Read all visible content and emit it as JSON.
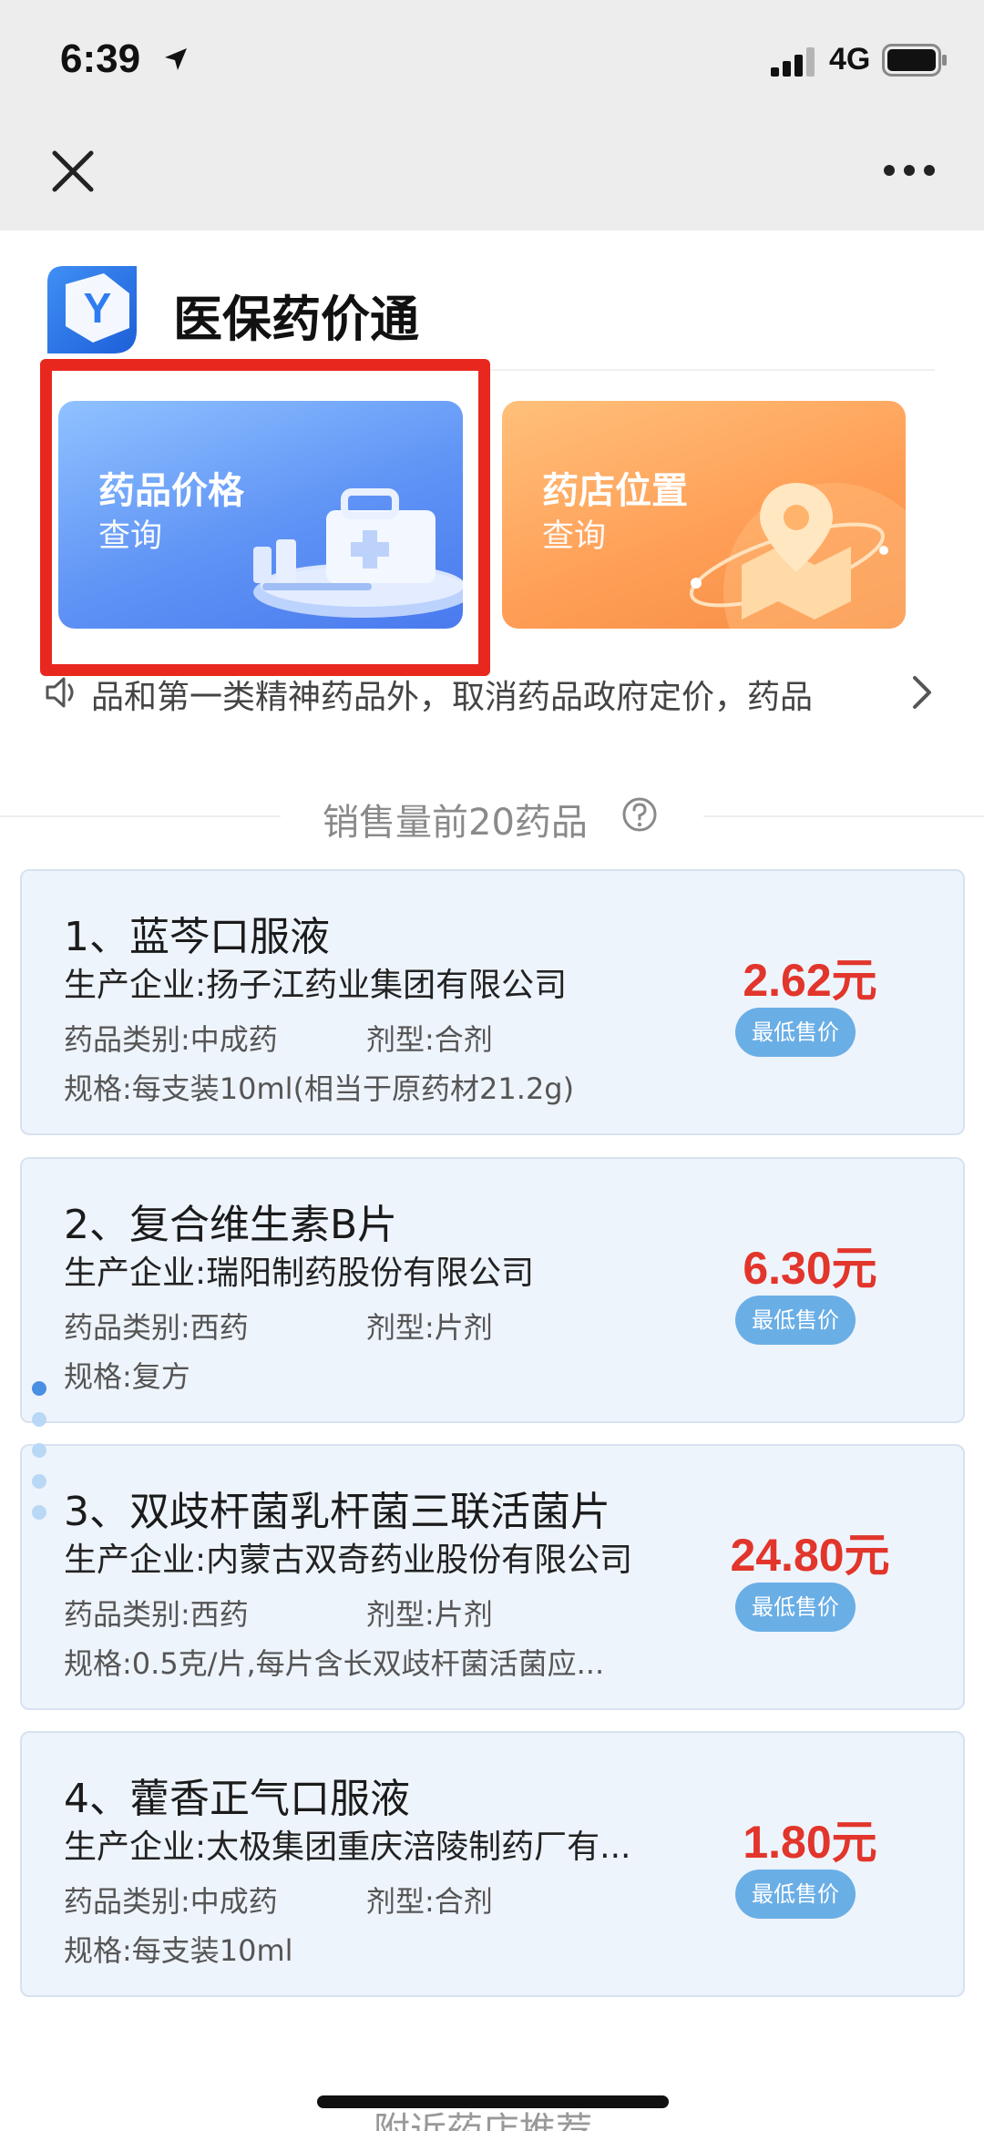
{
  "status_bar": {
    "time": "6:39",
    "network": "4G"
  },
  "header": {
    "title": "医保药价通",
    "logo_letter": "Y"
  },
  "features": [
    {
      "title": "药品价格",
      "subtitle": "查询"
    },
    {
      "title": "药店位置",
      "subtitle": "查询"
    }
  ],
  "notice": {
    "text": "品和第一类精神药品外，取消药品政府定价，药品"
  },
  "section": {
    "title": "销售量前20药品"
  },
  "drugs": [
    {
      "name": "1、蓝芩口服液",
      "maker": "生产企业:扬子江药业集团有限公司",
      "category": "药品类别:中成药",
      "form": "剂型:合剂",
      "spec": "规格:每支装10ml(相当于原药材21.2g)",
      "price": "2.62元",
      "badge": "最低售价"
    },
    {
      "name": "2、复合维生素B片",
      "maker": "生产企业:瑞阳制药股份有限公司",
      "category": "药品类别:西药",
      "form": "剂型:片剂",
      "spec": "规格:复方",
      "price": "6.30元",
      "badge": "最低售价"
    },
    {
      "name": "3、双歧杆菌乳杆菌三联活菌片",
      "maker": "生产企业:内蒙古双奇药业股份有限公司",
      "category": "药品类别:西药",
      "form": "剂型:片剂",
      "spec": "规格:0.5克/片,每片含长双歧杆菌活菌应...",
      "price": "24.80元",
      "badge": "最低售价"
    },
    {
      "name": "4、藿香正气口服液",
      "maker": "生产企业:太极集团重庆涪陵制药厂有...",
      "category": "药品类别:中成药",
      "form": "剂型:合剂",
      "spec": "规格:每支装10ml",
      "price": "1.80元",
      "badge": "最低售价"
    }
  ],
  "bottom": {
    "text": "附近药店推荐"
  }
}
